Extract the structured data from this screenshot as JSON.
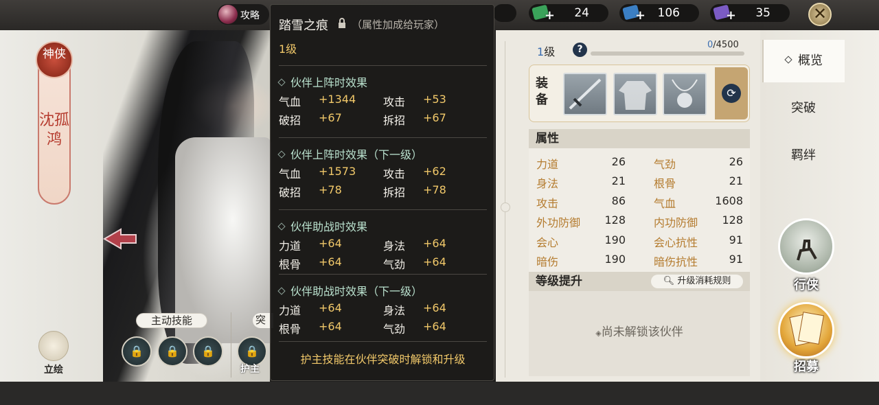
{
  "top_bar": {
    "guide_label": "攻略",
    "resources": [
      {
        "icon": "green-ticket-icon",
        "color": "#3aa25a",
        "value": "24"
      },
      {
        "icon": "blue-ticket-icon",
        "color": "#3b7fc4",
        "value": "106"
      },
      {
        "icon": "purple-ticket-icon",
        "color": "#7b5bc4",
        "value": "35"
      }
    ],
    "close_symbol": "✕"
  },
  "hero": {
    "badge": "神侠",
    "name": "沈孤鸿",
    "portrait_label": "立绘",
    "active_skill_title": "主动技能",
    "guard_skill_title": "突",
    "guard_label": "护主",
    "lock_symbol": "🔒"
  },
  "popup": {
    "title": "踏雪之痕",
    "note": "（属性加成给玩家）",
    "level": "1级",
    "sections": [
      {
        "title": "伙伴上阵时效果",
        "stats": [
          {
            "name": "气血",
            "value": "+1344"
          },
          {
            "name": "攻击",
            "value": "+53"
          },
          {
            "name": "破招",
            "value": "+67"
          },
          {
            "name": "拆招",
            "value": "+67"
          }
        ]
      },
      {
        "title": "伙伴上阵时效果（下一级）",
        "stats": [
          {
            "name": "气血",
            "value": "+1573"
          },
          {
            "name": "攻击",
            "value": "+62"
          },
          {
            "name": "破招",
            "value": "+78"
          },
          {
            "name": "拆招",
            "value": "+78"
          }
        ]
      },
      {
        "title": "伙伴助战时效果",
        "stats": [
          {
            "name": "力道",
            "value": "+64"
          },
          {
            "name": "身法",
            "value": "+64"
          },
          {
            "name": "根骨",
            "value": "+64"
          },
          {
            "name": "气劲",
            "value": "+64"
          }
        ]
      },
      {
        "title": "伙伴助战时效果（下一级）",
        "stats": [
          {
            "name": "力道",
            "value": "+64"
          },
          {
            "name": "身法",
            "value": "+64"
          },
          {
            "name": "根骨",
            "value": "+64"
          },
          {
            "name": "气劲",
            "value": "+64"
          }
        ]
      }
    ],
    "footer": "护主技能在伙伴突破时解锁和升级"
  },
  "right": {
    "level_num": "1",
    "level_unit": "级",
    "help_symbol": "?",
    "xp_current": "0",
    "xp_max": "/4500",
    "xp_fraction": 0,
    "equip_label": "装备",
    "swap_symbol": "⟳",
    "attr_title": "属性",
    "attributes": [
      {
        "name": "力道",
        "value": "26"
      },
      {
        "name": "气劲",
        "value": "26"
      },
      {
        "name": "身法",
        "value": "21"
      },
      {
        "name": "根骨",
        "value": "21"
      },
      {
        "name": "攻击",
        "value": "86"
      },
      {
        "name": "气血",
        "value": "1608"
      },
      {
        "name": "外功防御",
        "value": "128"
      },
      {
        "name": "内功防御",
        "value": "128"
      },
      {
        "name": "会心",
        "value": "190"
      },
      {
        "name": "会心抗性",
        "value": "91"
      },
      {
        "name": "暗伤",
        "value": "190"
      },
      {
        "name": "暗伤抗性",
        "value": "91"
      }
    ],
    "upgrade_title": "等级提升",
    "upgrade_rule": "升级消耗规则",
    "locked_text": "尚未解锁该伙伴"
  },
  "tabs": [
    {
      "label": "概览",
      "active": true
    },
    {
      "label": "突破",
      "active": false
    },
    {
      "label": "羁绊",
      "active": false
    }
  ],
  "actions": {
    "xingxia": "行侠",
    "zhaomu": "招募"
  }
}
